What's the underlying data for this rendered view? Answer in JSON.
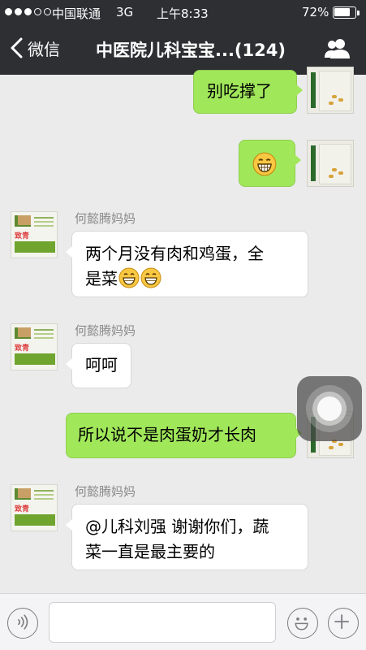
{
  "status_bar": {
    "carrier": "中国联通",
    "network": "3G",
    "time": "上午8:33",
    "battery_percent": "72%",
    "signal_bars_filled": 3,
    "signal_bars_total": 5,
    "battery_level": 0.72
  },
  "nav": {
    "back_label": "微信",
    "title": "中医院儿科宝宝...(124)",
    "back_icon": "chevron-left-icon",
    "group_icon": "group-members-icon"
  },
  "messages": [
    {
      "side": "right",
      "text": "别吃撑了"
    },
    {
      "side": "right",
      "text": "",
      "emoji": "grin-emoji"
    },
    {
      "side": "left",
      "sender": "何懿腾妈妈",
      "line1": "两个月没有肉和鸡蛋，全",
      "line2": "是菜"
    },
    {
      "side": "left",
      "sender": "何懿腾妈妈",
      "text": "呵呵"
    },
    {
      "side": "right",
      "text": "所以说不是肉蛋奶才长肉"
    },
    {
      "side": "left",
      "sender": "何懿腾妈妈",
      "line1": "@儿科刘强 谢谢你们，蔬",
      "line2": "菜一直是最主要的"
    }
  ],
  "avatar_text": "致青春",
  "input_bar": {
    "placeholder": "",
    "voice_icon": "voice-icon",
    "emoji_icon": "smiley-icon",
    "plus_icon": "plus-icon"
  },
  "colors": {
    "header_bg": "#2e2f33",
    "chat_bg": "#ebebeb",
    "bubble_sent": "#a0e75a",
    "bubble_received": "#ffffff"
  }
}
